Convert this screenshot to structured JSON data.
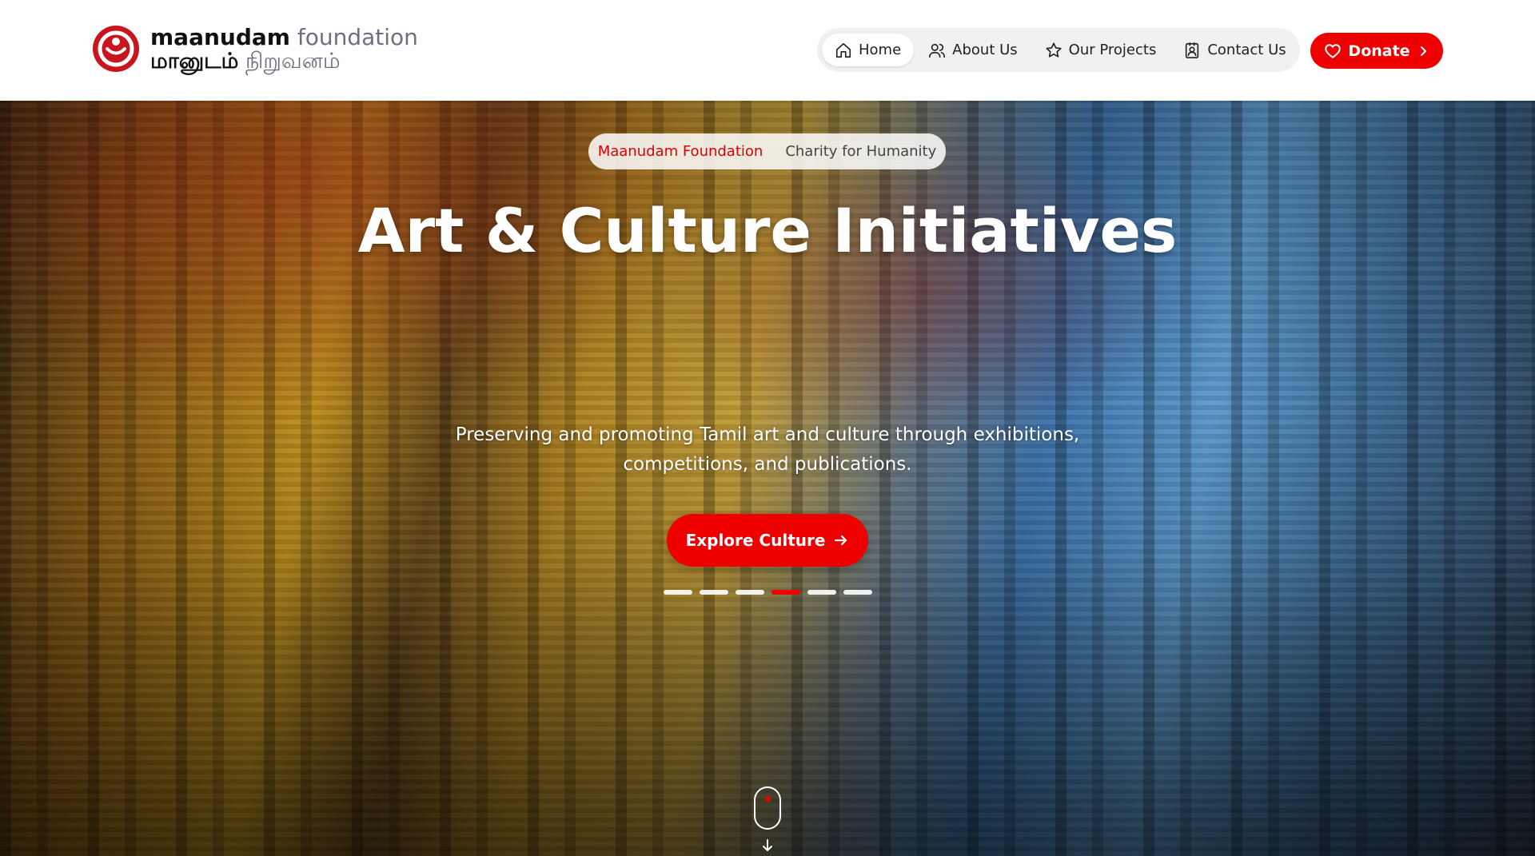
{
  "logo": {
    "name_en_bold": "maanudam",
    "name_en_light": "foundation",
    "name_ta_bold": "மானுடம்",
    "name_ta_light": "நிறுவனம்",
    "icon": "maanudam-logo"
  },
  "nav": {
    "items": [
      {
        "label": "Home",
        "icon": "home-icon",
        "active": true
      },
      {
        "label": "About Us",
        "icon": "users-icon",
        "active": false
      },
      {
        "label": "Our Projects",
        "icon": "star-icon",
        "active": false
      },
      {
        "label": "Contact Us",
        "icon": "contact-icon",
        "active": false
      }
    ],
    "donate_label": "Donate"
  },
  "hero": {
    "pill_primary": "Maanudam Foundation",
    "pill_secondary": "Charity for Humanity",
    "title": "Art & Culture Initiatives",
    "subtitle": "Preserving and promoting Tamil art and culture through exhibitions, competitions, and publications.",
    "cta_label": "Explore Culture",
    "slides_total": 6,
    "active_slide": 4
  },
  "colors": {
    "accent": "#ee0000",
    "text_dark": "#111111",
    "text_muted": "#6b6f80"
  }
}
